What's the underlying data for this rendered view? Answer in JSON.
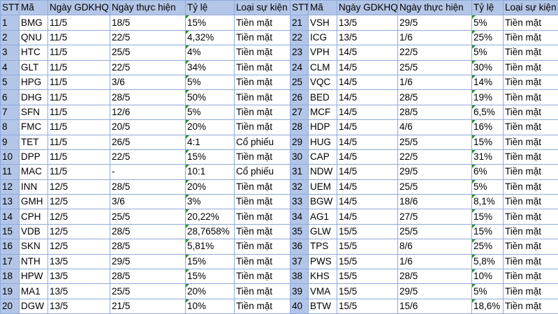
{
  "headers": [
    "STT",
    "Mã",
    "Ngày GDKHQ",
    "Ngày thực hiện",
    "Tỷ lệ",
    "Loại sự kiện"
  ],
  "rows": [
    [
      "1",
      "BMG",
      "11/5",
      "18/5",
      "15%",
      "Tiền mặt",
      "21",
      "VSH",
      "13/5",
      "29/5",
      "5%",
      "Tiền mặt"
    ],
    [
      "2",
      "QNU",
      "11/5",
      "22/5",
      "4,32%",
      "Tiền mặt",
      "22",
      "ICG",
      "13/5",
      "1/6",
      "25%",
      "Tiền mặt"
    ],
    [
      "3",
      "HTC",
      "11/5",
      "25/5",
      "4%",
      "Tiền mặt",
      "23",
      "VPH",
      "14/5",
      "22/5",
      "5%",
      "Tiền mặt"
    ],
    [
      "4",
      "GLT",
      "11/5",
      "22/5",
      "34%",
      "Tiền mặt",
      "24",
      "CLM",
      "14/5",
      "25/5",
      "30%",
      "Tiền mặt"
    ],
    [
      "5",
      "HPG",
      "11/5",
      "3/6",
      "5%",
      "Tiền mặt",
      "25",
      "VQC",
      "14/5",
      "1/6",
      "14%",
      "Tiền mặt"
    ],
    [
      "6",
      "DHG",
      "11/5",
      "28/5",
      "50%",
      "Tiền mặt",
      "26",
      "BED",
      "14/5",
      "28/5",
      "19%",
      "Tiền mặt"
    ],
    [
      "7",
      "SFN",
      "11/5",
      "12/6",
      "5%",
      "Tiền mặt",
      "27",
      "MCF",
      "14/5",
      "28/5",
      "6,5%",
      "Tiền mặt"
    ],
    [
      "8",
      "FMC",
      "11/5",
      "20/5",
      "20%",
      "Tiền mặt",
      "28",
      "HDP",
      "14/5",
      "4/6",
      "16%",
      "Tiền mặt"
    ],
    [
      "9",
      "TET",
      "11/5",
      "26/5",
      "4:1",
      "Cổ phiếu",
      "29",
      "HUG",
      "14/5",
      "25/5",
      "15%",
      "Tiền mặt"
    ],
    [
      "10",
      "DPP",
      "11/5",
      "22/5",
      "15%",
      "Tiền mặt",
      "30",
      "CAP",
      "14/5",
      "22/5",
      "31%",
      "Tiền mặt"
    ],
    [
      "11",
      "MAC",
      "11/5",
      "-",
      "10:1",
      "Cổ phiếu",
      "31",
      "NDW",
      "14/5",
      "29/5",
      "6%",
      "Tiền mặt"
    ],
    [
      "12",
      "INN",
      "12/5",
      "28/5",
      "20%",
      "Tiền mặt",
      "32",
      "UEM",
      "14/5",
      "25/5",
      "5%",
      "Tiền mặt"
    ],
    [
      "13",
      "GMH",
      "12/5",
      "3/6",
      "3%",
      "Tiền mặt",
      "33",
      "BGW",
      "14/5",
      "18/6",
      "8,1%",
      "Tiền mặt"
    ],
    [
      "14",
      "CPH",
      "12/5",
      "25/5",
      "20,22%",
      "Tiền mặt",
      "34",
      "AG1",
      "14/5",
      "27/5",
      "15%",
      "Tiền mặt"
    ],
    [
      "15",
      "VDB",
      "12/5",
      "28/5",
      "28,7658%",
      "Tiền mặt",
      "35",
      "GLW",
      "15/5",
      "25/5",
      "15%",
      "Tiền mặt"
    ],
    [
      "16",
      "SKN",
      "12/5",
      "28/5",
      "5,81%",
      "Tiền mặt",
      "36",
      "TPS",
      "15/5",
      "8/6",
      "25%",
      "Tiền mặt"
    ],
    [
      "17",
      "NTH",
      "13/5",
      "29/5",
      "15%",
      "Tiền mặt",
      "37",
      "PWS",
      "15/5",
      "1/6",
      "5,8%",
      "Tiền mặt"
    ],
    [
      "18",
      "HPW",
      "13/5",
      "28/5",
      "15%",
      "Tiền mặt",
      "38",
      "KHS",
      "15/5",
      "28/5",
      "10%",
      "Tiền mặt"
    ],
    [
      "19",
      "MA1",
      "13/5",
      "25/5",
      "20%",
      "Tiền mặt",
      "39",
      "VMA",
      "15/5",
      "29/5",
      "5%",
      "Tiền mặt"
    ],
    [
      "20",
      "DGW",
      "13/5",
      "21/5",
      "10%",
      "Tiền mặt",
      "40",
      "BTW",
      "15/5",
      "15/6",
      "18,6%",
      "Tiền mặt"
    ]
  ],
  "colors": {
    "header_fill": "#b4c6e7",
    "grid_line": "#8ea9db",
    "comment_marker": "#2e8b2e"
  }
}
